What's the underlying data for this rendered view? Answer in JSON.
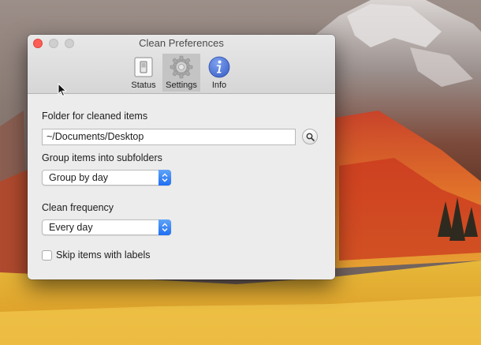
{
  "window": {
    "title": "Clean Preferences"
  },
  "toolbar": {
    "items": [
      {
        "label": "Status",
        "icon": "switch-icon"
      },
      {
        "label": "Settings",
        "icon": "gear-icon",
        "selected": true
      },
      {
        "label": "Info",
        "icon": "info-icon"
      }
    ]
  },
  "settings": {
    "folder_label": "Folder for cleaned items",
    "folder_value": "~/Documents/Desktop",
    "group_label": "Group items into subfolders",
    "group_selected": "Group by day",
    "frequency_label": "Clean frequency",
    "frequency_selected": "Every day",
    "skip_labels_text": "Skip items with labels",
    "skip_labels_checked": false
  },
  "colors": {
    "close_button": "#fd5f57",
    "popup_accent": "#1f6ef2",
    "info_icon": "#4a75d6"
  }
}
